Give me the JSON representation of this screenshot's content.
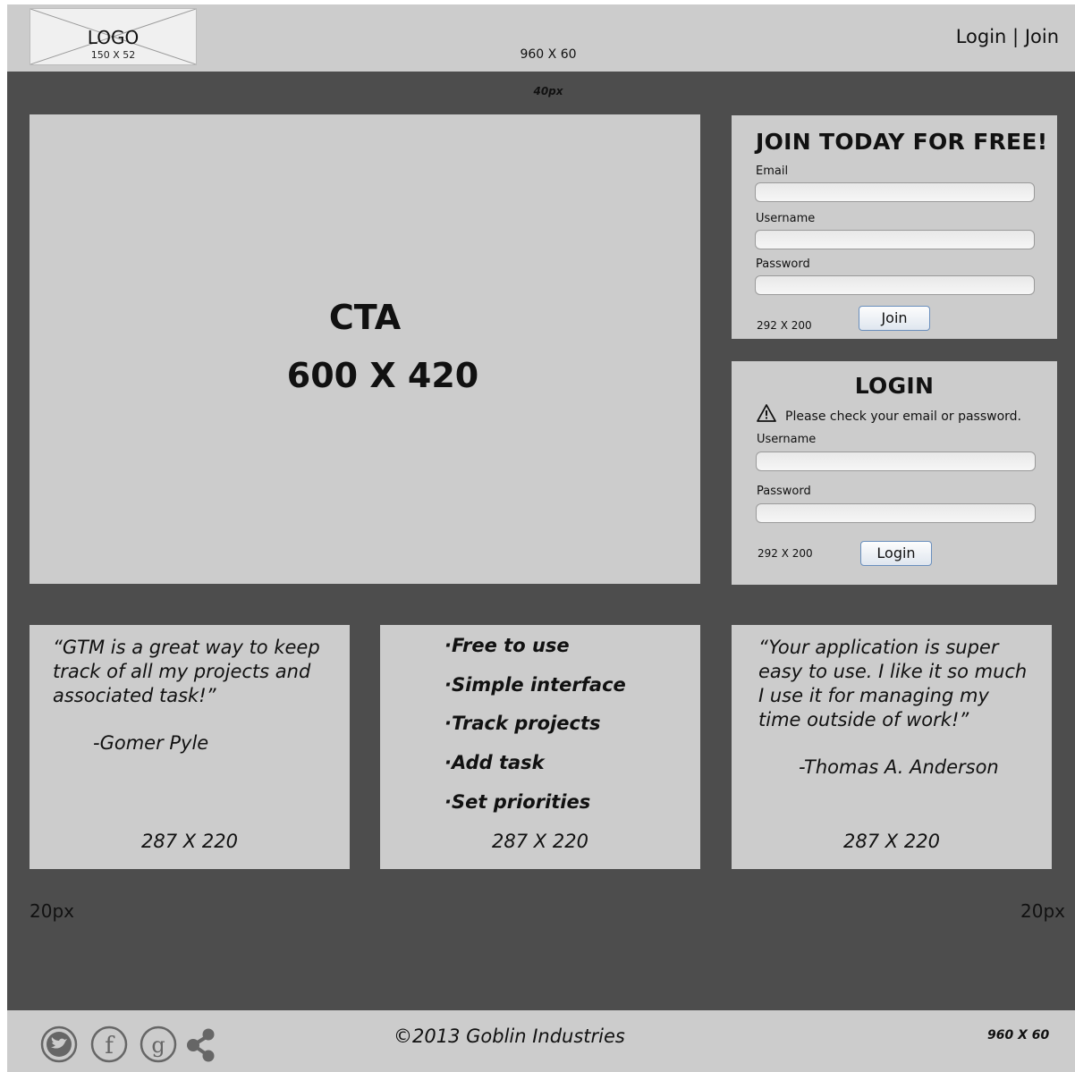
{
  "header": {
    "logo_text": "LOGO",
    "logo_size": "150 X 52",
    "dimension": "960 X 60",
    "login_link": "Login",
    "separator": "|",
    "join_link": "Join"
  },
  "gap_label": "40px",
  "cta": {
    "title": "CTA",
    "size": "600 X 420"
  },
  "join_panel": {
    "heading": "JOIN TODAY FOR FREE!",
    "email_label": "Email",
    "username_label": "Username",
    "password_label": "Password",
    "dimension": "292 X 200",
    "button_label": "Join"
  },
  "login_panel": {
    "heading": "LOGIN",
    "warning": "Please check your email or password.",
    "username_label": "Username",
    "password_label": "Password",
    "dimension": "292 X 200",
    "button_label": "Login"
  },
  "testimonial_left": {
    "lines": [
      "“GTM is a great way to keep",
      "track of all my projects and",
      "associated task!”"
    ],
    "author": "-Gomer Pyle",
    "dimension": "287 X 220"
  },
  "features": {
    "items": [
      "Free to use",
      "Simple interface",
      "Track projects",
      "Add task",
      "Set priorities"
    ],
    "dimension": "287 X 220"
  },
  "testimonial_right": {
    "lines": [
      "“Your application is super",
      "easy to use. I like it so much",
      "I use it for managing my",
      "time outside of work!”"
    ],
    "author": "-Thomas A. Anderson",
    "dimension": "287 X 220"
  },
  "margins": {
    "left_label": "20px",
    "right_label": "20px"
  },
  "footer": {
    "social_icons": [
      "twitter-icon",
      "facebook-icon",
      "google-plus-icon",
      "share-icon"
    ],
    "copyright": "©2013 Goblin Industries",
    "dimension": "960 X 60"
  },
  "colors": {
    "background": "#4d4d4d",
    "panel": "#cccccc",
    "button_border": "#6a8fbd"
  }
}
